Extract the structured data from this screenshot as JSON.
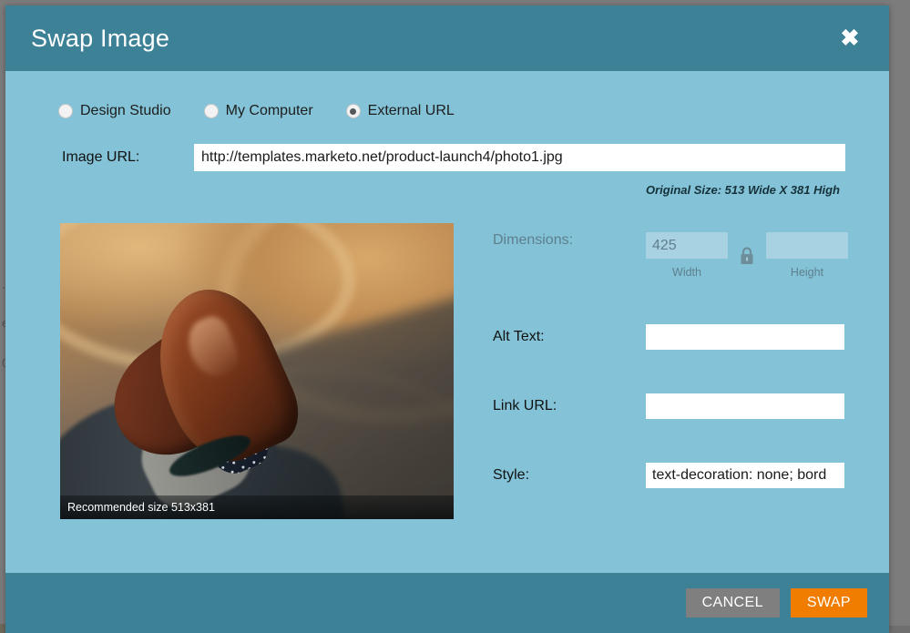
{
  "background": {
    "fragments": [
      "..",
      "..",
      ".0",
      "e",
      "0"
    ]
  },
  "modal": {
    "title": "Swap Image",
    "close_label": "✖",
    "header_color": "#3c8195",
    "body_color": "#84c3d7"
  },
  "source_options": [
    {
      "label": "Design Studio",
      "selected": false
    },
    {
      "label": "My Computer",
      "selected": false
    },
    {
      "label": "External URL",
      "selected": true
    }
  ],
  "image_url": {
    "label": "Image URL:",
    "value": "http://templates.marketo.net/product-launch4/photo1.jpg",
    "placeholder": ""
  },
  "original_size": "Original Size: 513 Wide X 381 High",
  "preview": {
    "caption": "Recommended size 513x381",
    "alt": "Brown leather dress shoes resting on a patterned floor"
  },
  "fields": {
    "dimensions": {
      "label": "Dimensions:",
      "width_value": "425",
      "width_caption": "Width",
      "height_value": "",
      "height_caption": "Height",
      "lock_icon": "lock-closed-icon",
      "disabled": true
    },
    "alt_text": {
      "label": "Alt Text:",
      "value": "",
      "placeholder": ""
    },
    "link_url": {
      "label": "Link URL:",
      "value": "",
      "placeholder": ""
    },
    "style": {
      "label": "Style:",
      "value": "text-decoration: none; bord",
      "placeholder": ""
    }
  },
  "footer": {
    "cancel_label": "CANCEL",
    "swap_label": "SWAP",
    "cancel_color": "#7f7f7f",
    "swap_color": "#f07d00"
  }
}
